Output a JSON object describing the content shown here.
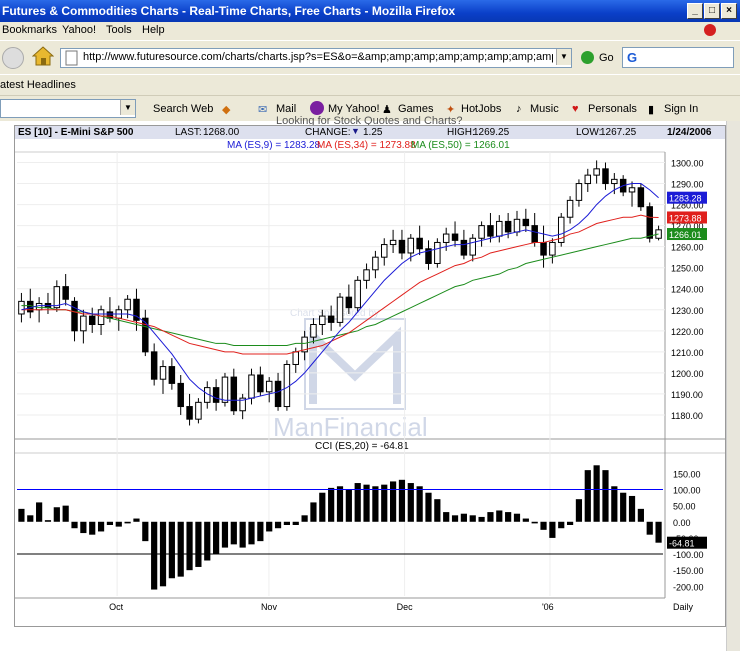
{
  "window": {
    "title": "Futures & Commodities Charts - Real-Time Charts, Free Charts - Mozilla Firefox",
    "min_glyph": "_",
    "max_glyph": "□",
    "close_glyph": "×"
  },
  "menu": [
    "Bookmarks",
    "Yahoo!",
    "Tools",
    "Help"
  ],
  "nav": {
    "url": "http://www.futuresource.com/charts/charts.jsp?s=ES&o=&amp;amp;amp;amp;amp;amp;amp;amp;amp;amp;a=D&",
    "go_label": "Go",
    "search_letter": "G"
  },
  "headlines_label": "atest Headlines",
  "toolbar": {
    "search_web": "Search Web",
    "mail": "Mail",
    "my_yahoo": "My Yahoo!",
    "games": "Games",
    "hotjobs": "HotJobs",
    "music": "Music",
    "personals": "Personals",
    "sign_in": "Sign In"
  },
  "partial_text": "Looking for Stock Quotes and Charts?",
  "quote": {
    "symbol": "ES [10] - E-Mini S&P 500",
    "last_label": "LAST:",
    "last": "1268.00",
    "change_label": "CHANGE:",
    "change": "1.25",
    "high_label": "HIGH:",
    "high": "1269.25",
    "low_label": "LOW:",
    "low": "1267.25",
    "date": "1/24/2006"
  },
  "ma_legend": {
    "ma9": "MA (ES,9) = 1283.28",
    "ma34": "MA (ES,34) = 1273.88",
    "ma50": "MA (ES,50) = 1266.01"
  },
  "cci_legend": "CCI (ES,20) = -64.81",
  "watermark": {
    "line1": "Chart Sponsored by",
    "line2": "ManFinancial"
  },
  "colors": {
    "ma9": "#1c1cd6",
    "ma34": "#e0201c",
    "ma50": "#1c8c1c",
    "candle": "#000000",
    "cci_line": "#0000ff"
  },
  "chart_data": [
    {
      "type": "candlestick",
      "title": "ES [10] - E-Mini S&P 500",
      "ylim": [
        1170,
        1305
      ],
      "y_ticks": [
        "1300.00",
        "1290.00",
        "1280.00",
        "1270.00",
        "1260.00",
        "1250.00",
        "1240.00",
        "1230.00",
        "1220.00",
        "1210.00",
        "1200.00",
        "1190.00",
        "1180.00"
      ],
      "x_ticks": [
        "Oct",
        "Nov",
        "Dec",
        "'06",
        "Daily"
      ],
      "last_labels": {
        "ma9": "1283.28",
        "ma34": "1273.88",
        "ma50": "1266.01"
      },
      "ohlc": [
        [
          1228,
          1238,
          1224,
          1234
        ],
        [
          1234,
          1240,
          1226,
          1229
        ],
        [
          1230,
          1236,
          1224,
          1233
        ],
        [
          1233,
          1238,
          1228,
          1231
        ],
        [
          1231,
          1244,
          1229,
          1241
        ],
        [
          1241,
          1247,
          1232,
          1235
        ],
        [
          1234,
          1236,
          1215,
          1220
        ],
        [
          1220,
          1230,
          1214,
          1227
        ],
        [
          1227,
          1231,
          1219,
          1223
        ],
        [
          1223,
          1232,
          1218,
          1230
        ],
        [
          1229,
          1236,
          1224,
          1226
        ],
        [
          1226,
          1232,
          1220,
          1230
        ],
        [
          1230,
          1237,
          1226,
          1235
        ],
        [
          1235,
          1240,
          1220,
          1225
        ],
        [
          1226,
          1230,
          1208,
          1210
        ],
        [
          1210,
          1214,
          1194,
          1197
        ],
        [
          1197,
          1206,
          1190,
          1203
        ],
        [
          1203,
          1207,
          1192,
          1195
        ],
        [
          1195,
          1199,
          1180,
          1184
        ],
        [
          1184,
          1190,
          1175,
          1178
        ],
        [
          1178,
          1188,
          1176,
          1186
        ],
        [
          1186,
          1196,
          1183,
          1193
        ],
        [
          1193,
          1197,
          1182,
          1186
        ],
        [
          1186,
          1200,
          1184,
          1198
        ],
        [
          1198,
          1202,
          1180,
          1182
        ],
        [
          1182,
          1190,
          1178,
          1188
        ],
        [
          1188,
          1202,
          1185,
          1199
        ],
        [
          1199,
          1203,
          1189,
          1191
        ],
        [
          1191,
          1198,
          1186,
          1196
        ],
        [
          1196,
          1200,
          1182,
          1184
        ],
        [
          1184,
          1206,
          1182,
          1204
        ],
        [
          1204,
          1212,
          1200,
          1210
        ],
        [
          1210,
          1220,
          1206,
          1217
        ],
        [
          1217,
          1226,
          1214,
          1223
        ],
        [
          1223,
          1230,
          1218,
          1227
        ],
        [
          1227,
          1232,
          1220,
          1224
        ],
        [
          1224,
          1238,
          1222,
          1236
        ],
        [
          1236,
          1242,
          1228,
          1231
        ],
        [
          1231,
          1246,
          1229,
          1244
        ],
        [
          1244,
          1252,
          1240,
          1249
        ],
        [
          1249,
          1258,
          1245,
          1255
        ],
        [
          1255,
          1264,
          1251,
          1261
        ],
        [
          1261,
          1268,
          1257,
          1263
        ],
        [
          1263,
          1268,
          1254,
          1257
        ],
        [
          1257,
          1266,
          1253,
          1264
        ],
        [
          1264,
          1270,
          1256,
          1259
        ],
        [
          1259,
          1263,
          1249,
          1252
        ],
        [
          1252,
          1264,
          1250,
          1262
        ],
        [
          1262,
          1269,
          1258,
          1266
        ],
        [
          1266,
          1272,
          1260,
          1263
        ],
        [
          1263,
          1268,
          1254,
          1256
        ],
        [
          1256,
          1266,
          1253,
          1264
        ],
        [
          1264,
          1272,
          1260,
          1270
        ],
        [
          1270,
          1276,
          1262,
          1265
        ],
        [
          1265,
          1275,
          1262,
          1272
        ],
        [
          1272,
          1276,
          1264,
          1267
        ],
        [
          1267,
          1277,
          1265,
          1273
        ],
        [
          1273,
          1278,
          1267,
          1270
        ],
        [
          1270,
          1276,
          1260,
          1262
        ],
        [
          1262,
          1270,
          1250,
          1256
        ],
        [
          1256,
          1264,
          1252,
          1262
        ],
        [
          1262,
          1276,
          1260,
          1274
        ],
        [
          1274,
          1284,
          1271,
          1282
        ],
        [
          1282,
          1292,
          1279,
          1290
        ],
        [
          1290,
          1297,
          1286,
          1294
        ],
        [
          1294,
          1301,
          1290,
          1297
        ],
        [
          1297,
          1300,
          1287,
          1290
        ],
        [
          1290,
          1295,
          1285,
          1292
        ],
        [
          1292,
          1294,
          1284,
          1286
        ],
        [
          1286,
          1291,
          1279,
          1288
        ],
        [
          1288,
          1290,
          1277,
          1279
        ],
        [
          1279,
          1281,
          1262,
          1264
        ],
        [
          1264,
          1270,
          1263,
          1268
        ]
      ],
      "ma9": [
        1230,
        1231,
        1232,
        1232,
        1232,
        1233,
        1231,
        1229,
        1228,
        1228,
        1228,
        1228,
        1228,
        1227,
        1224,
        1219,
        1214,
        1209,
        1203,
        1197,
        1193,
        1190,
        1188,
        1187,
        1187,
        1187,
        1188,
        1189,
        1190,
        1191,
        1193,
        1196,
        1200,
        1205,
        1210,
        1215,
        1220,
        1224,
        1229,
        1234,
        1239,
        1244,
        1248,
        1252,
        1255,
        1257,
        1258,
        1259,
        1260,
        1261,
        1261,
        1262,
        1263,
        1264,
        1265,
        1266,
        1267,
        1268,
        1267,
        1266,
        1265,
        1266,
        1268,
        1271,
        1275,
        1280,
        1284,
        1287,
        1289,
        1290,
        1290,
        1287,
        1283.28
      ],
      "ma34": [
        1230,
        1230,
        1230,
        1230,
        1230,
        1230,
        1229,
        1228,
        1228,
        1227,
        1227,
        1226,
        1225,
        1224,
        1223,
        1222,
        1220,
        1218,
        1216,
        1214,
        1213,
        1212,
        1211,
        1210,
        1210,
        1209,
        1209,
        1209,
        1209,
        1209,
        1209,
        1210,
        1211,
        1212,
        1213,
        1215,
        1217,
        1219,
        1222,
        1225,
        1228,
        1231,
        1234,
        1237,
        1240,
        1243,
        1245,
        1247,
        1249,
        1251,
        1252,
        1254,
        1255,
        1257,
        1258,
        1259,
        1260,
        1261,
        1262,
        1262,
        1263,
        1264,
        1266,
        1267,
        1269,
        1271,
        1272,
        1273,
        1274,
        1274,
        1275,
        1274,
        1273.88
      ],
      "ma50": [
        1232,
        1232,
        1231,
        1231,
        1230,
        1230,
        1229,
        1229,
        1228,
        1227,
        1226,
        1225,
        1224,
        1223,
        1222,
        1221,
        1220,
        1219,
        1218,
        1217,
        1216,
        1215,
        1214,
        1214,
        1213,
        1213,
        1213,
        1213,
        1213,
        1213,
        1213,
        1214,
        1214,
        1215,
        1216,
        1217,
        1218,
        1219,
        1220,
        1222,
        1223,
        1225,
        1227,
        1229,
        1231,
        1233,
        1235,
        1237,
        1239,
        1241,
        1242,
        1244,
        1245,
        1246,
        1247,
        1249,
        1250,
        1252,
        1253,
        1254,
        1255,
        1256,
        1257,
        1258,
        1259,
        1260,
        1261,
        1262,
        1263,
        1264,
        1264,
        1265,
        1266.01
      ]
    },
    {
      "type": "bar",
      "title": "CCI (ES,20) = -64.81",
      "ylim": [
        -230,
        210
      ],
      "y_ticks": [
        "150.00",
        "100.00",
        "50.00",
        "0.00",
        "-50.00",
        "-100.00",
        "-150.00",
        "-200.00"
      ],
      "reference_lines": [
        100,
        -100
      ],
      "last_label": "-64.81",
      "values": [
        40,
        20,
        60,
        5,
        45,
        50,
        -20,
        -35,
        -40,
        -30,
        -10,
        -15,
        -5,
        10,
        -60,
        -210,
        -200,
        -175,
        -170,
        -150,
        -140,
        -120,
        -100,
        -80,
        -70,
        -80,
        -70,
        -60,
        -30,
        -20,
        -10,
        -10,
        20,
        60,
        90,
        105,
        110,
        100,
        120,
        115,
        110,
        115,
        125,
        130,
        120,
        110,
        90,
        70,
        30,
        20,
        25,
        20,
        15,
        30,
        35,
        30,
        25,
        10,
        -5,
        -25,
        -50,
        -20,
        -10,
        70,
        160,
        175,
        160,
        110,
        90,
        80,
        40,
        -40,
        -64.81
      ]
    }
  ]
}
